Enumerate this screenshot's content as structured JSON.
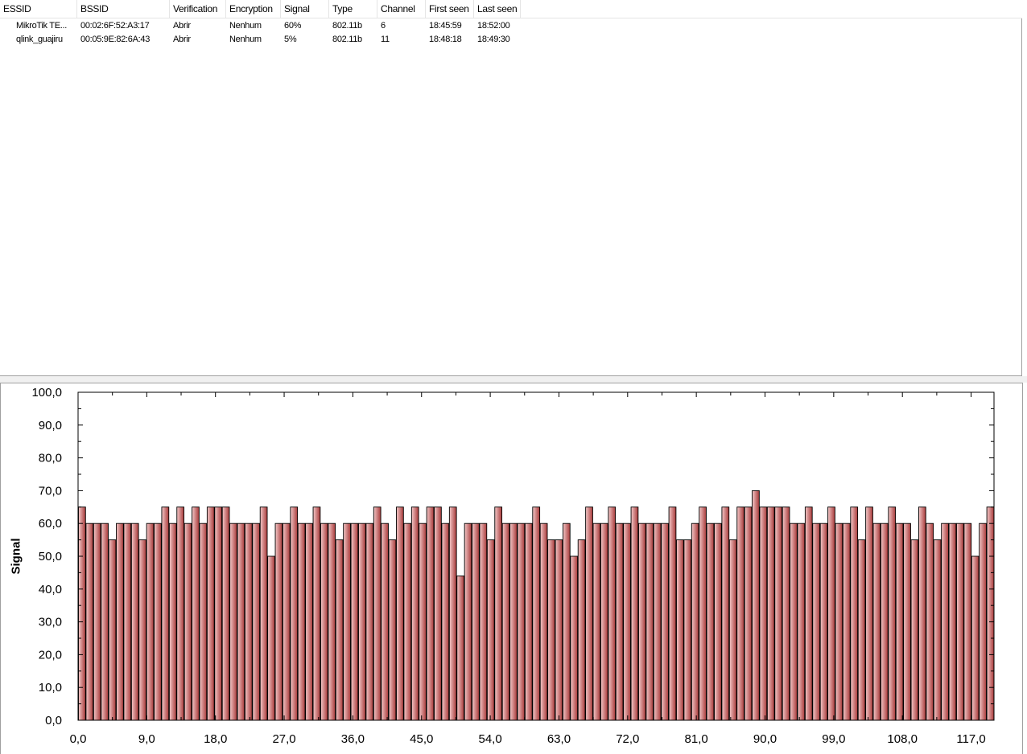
{
  "list": {
    "columns": [
      "ESSID",
      "BSSID",
      "Verification",
      "Encryption",
      "Signal",
      "Type",
      "Channel",
      "First seen",
      "Last seen"
    ],
    "rows": [
      {
        "essid": "MikroTik TE...",
        "bssid": "00:02:6F:52:A3:17",
        "verification": "Abrir",
        "encryption": "Nenhum",
        "signal": "60%",
        "type": "802.11b",
        "channel": "6",
        "first_seen": "18:45:59",
        "last_seen": "18:52:00"
      },
      {
        "essid": "qlink_guajiru",
        "bssid": "00:05:9E:82:6A:43",
        "verification": "Abrir",
        "encryption": "Nenhum",
        "signal": "5%",
        "type": "802.11b",
        "channel": "11",
        "first_seen": "18:48:18",
        "last_seen": "18:49:30"
      }
    ]
  },
  "colors": {
    "bar_light": "#f3c8c8",
    "bar_dark": "#a83a3a",
    "bar_edge": "#000000"
  },
  "chart_data": {
    "type": "bar",
    "ylabel": "Signal",
    "xlabel": "",
    "title": "",
    "ylim": [
      0,
      100
    ],
    "xlim": [
      0,
      120
    ],
    "yticks": [
      "0,0",
      "10,0",
      "20,0",
      "30,0",
      "40,0",
      "50,0",
      "60,0",
      "70,0",
      "80,0",
      "90,0",
      "100,0"
    ],
    "xticks": [
      "0,0",
      "9,0",
      "18,0",
      "27,0",
      "36,0",
      "45,0",
      "54,0",
      "63,0",
      "72,0",
      "81,0",
      "90,0",
      "99,0",
      "108,0",
      "117,0"
    ],
    "values": [
      65,
      60,
      60,
      60,
      55,
      60,
      60,
      60,
      55,
      60,
      60,
      65,
      60,
      65,
      60,
      65,
      60,
      65,
      65,
      65,
      60,
      60,
      60,
      60,
      65,
      50,
      60,
      60,
      65,
      60,
      60,
      65,
      60,
      60,
      55,
      60,
      60,
      60,
      60,
      65,
      60,
      55,
      65,
      60,
      65,
      60,
      65,
      65,
      60,
      65,
      44,
      60,
      60,
      60,
      55,
      65,
      60,
      60,
      60,
      60,
      65,
      60,
      55,
      55,
      60,
      50,
      55,
      65,
      60,
      60,
      65,
      60,
      60,
      65,
      60,
      60,
      60,
      60,
      65,
      55,
      55,
      60,
      65,
      60,
      60,
      65,
      55,
      65,
      65,
      70,
      65,
      65,
      65,
      65,
      60,
      60,
      65,
      60,
      60,
      65,
      60,
      60,
      65,
      55,
      65,
      60,
      60,
      65,
      60,
      60,
      55,
      65,
      60,
      55,
      60,
      60,
      60,
      60,
      50,
      60,
      65
    ]
  }
}
